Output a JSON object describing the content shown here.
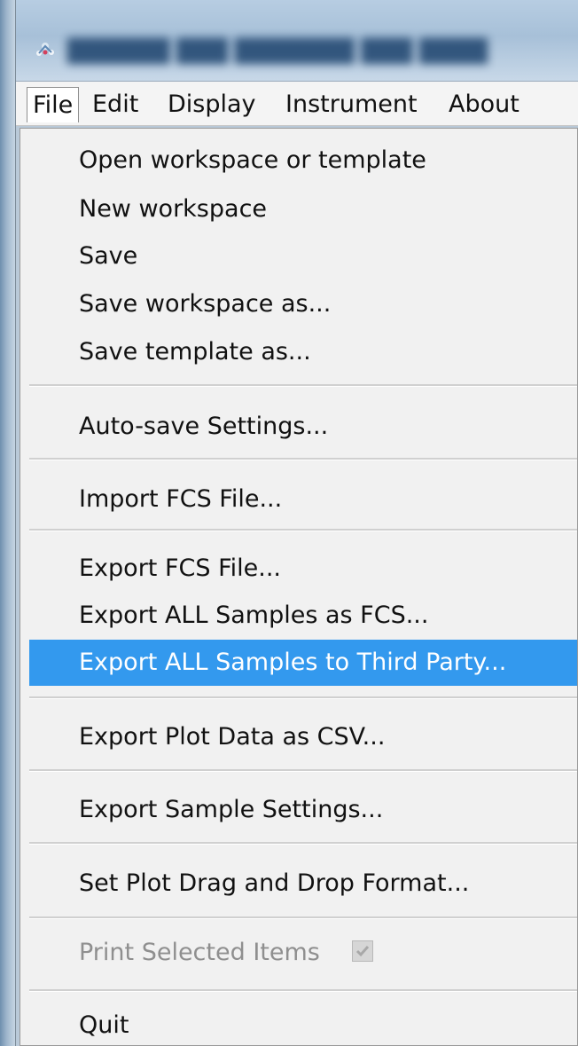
{
  "menu_bar": {
    "items": [
      {
        "label": "File"
      },
      {
        "label": "Edit"
      },
      {
        "label": "Display"
      },
      {
        "label": "Instrument"
      },
      {
        "label": "About"
      }
    ]
  },
  "file_menu": {
    "items": [
      {
        "label": "Open workspace or template"
      },
      {
        "label": "New workspace"
      },
      {
        "label": "Save"
      },
      {
        "label": "Save workspace as..."
      },
      {
        "label": "Save template as..."
      },
      {
        "label": "Auto-save Settings..."
      },
      {
        "label": "Import FCS File..."
      },
      {
        "label": "Export FCS File..."
      },
      {
        "label": "Export ALL Samples as FCS..."
      },
      {
        "label": "Export ALL Samples to Third Party..."
      },
      {
        "label": "Export Plot Data as CSV..."
      },
      {
        "label": "Export Sample Settings..."
      },
      {
        "label": "Set Plot Drag and Drop Format..."
      },
      {
        "label": "Print Selected Items"
      },
      {
        "label": "Quit"
      }
    ],
    "highlighted_item": "Export ALL Samples to Third Party...",
    "disabled_item": "Print Selected Items",
    "print_selected_checked": true
  },
  "colors": {
    "highlight": "#3399ee",
    "menu_background": "#f1f1f1",
    "disabled_text": "#8f8f8f"
  }
}
